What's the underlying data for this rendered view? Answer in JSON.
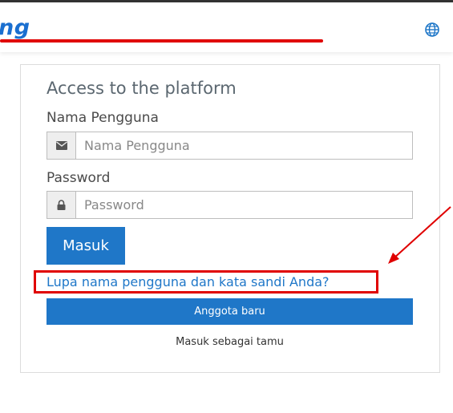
{
  "header": {
    "logo_text": "ng",
    "language_icon": "globe-icon"
  },
  "login": {
    "title": "Access to the platform",
    "username_label": "Nama Pengguna",
    "username_placeholder": "Nama Pengguna",
    "username_icon": "envelope-icon",
    "password_label": "Password",
    "password_placeholder": "Password",
    "password_icon": "lock-icon",
    "submit_label": "Masuk",
    "forgot_link": "Lupa nama pengguna dan kata sandi Anda?",
    "new_account_label": "Anggota baru",
    "guest_label": "Masuk sebagai tamu"
  },
  "colors": {
    "accent": "#1f77c8",
    "annotation_red": "#e00000"
  }
}
